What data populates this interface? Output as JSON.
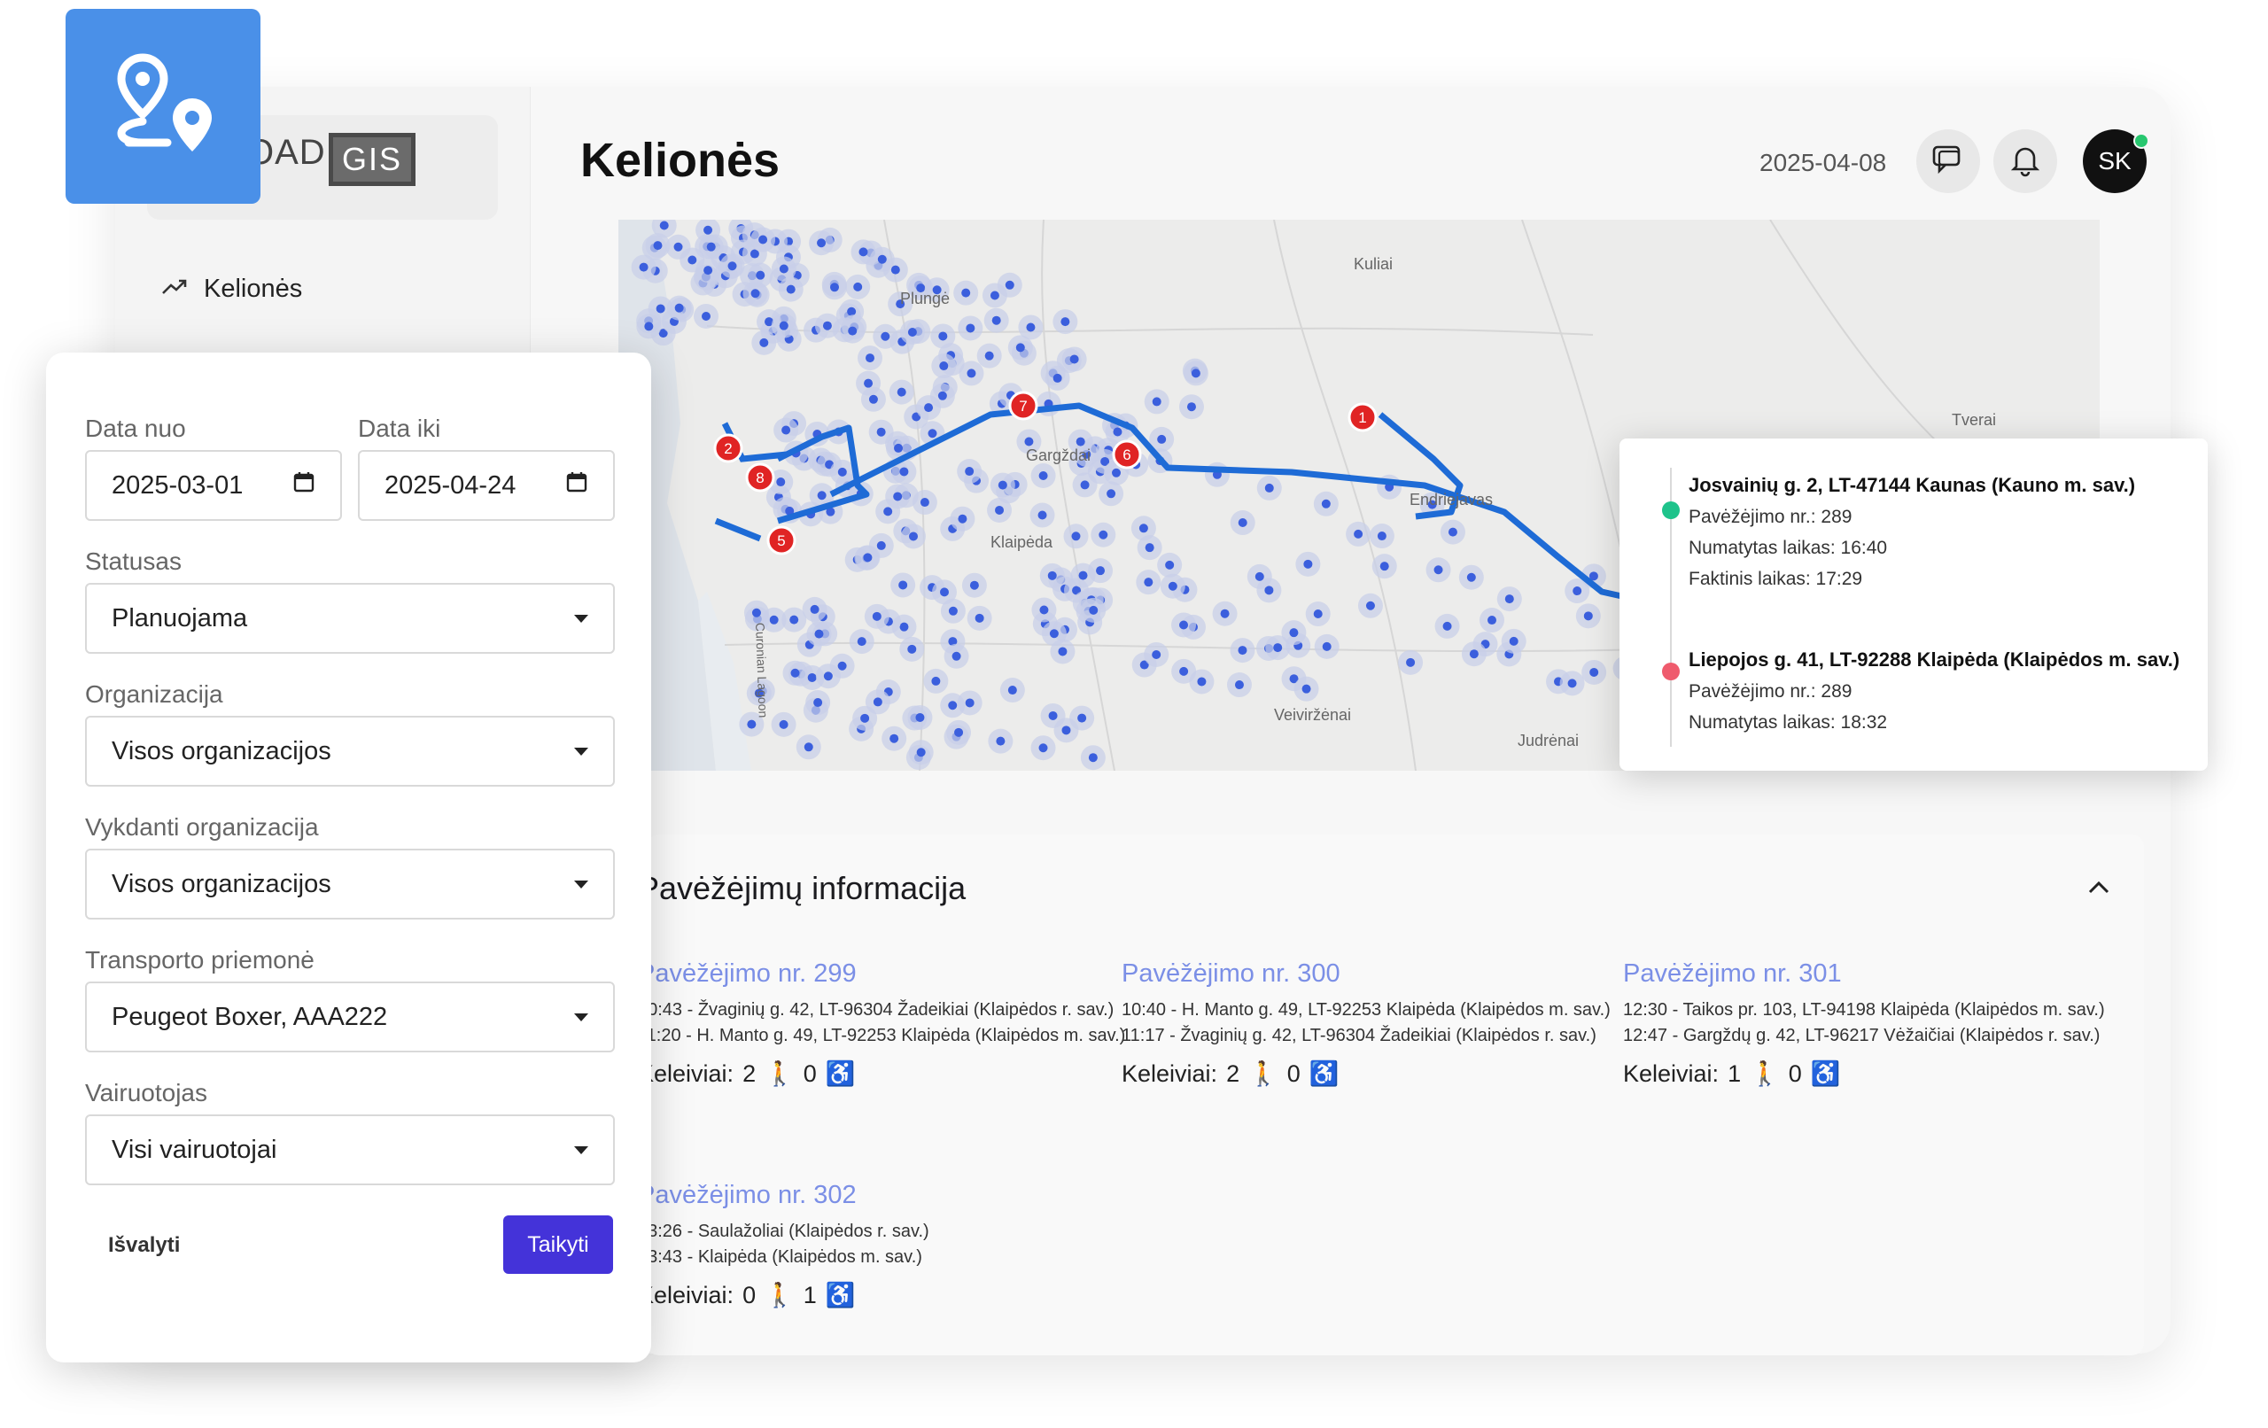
{
  "app": {
    "logo_text": "OAD",
    "logo_gis": "GIS",
    "page_title": "Kelionės",
    "date": "2025-04-08",
    "user_initials": "SK"
  },
  "sidebar": {
    "items": [
      {
        "label": "Kelionės",
        "icon": "trend-icon"
      }
    ]
  },
  "filters": {
    "date_from_label": "Data nuo",
    "date_from_value": "2025-03-01",
    "date_to_label": "Data iki",
    "date_to_value": "2025-04-24",
    "status_label": "Statusas",
    "status_value": "Planuojama",
    "organization_label": "Organizacija",
    "organization_value": "Visos organizacijos",
    "executing_org_label": "Vykdanti organizacija",
    "executing_org_value": "Visos organizacijos",
    "vehicle_label": "Transporto priemonė",
    "vehicle_value": "Peugeot Boxer, AAA222",
    "driver_label": "Vairuotojas",
    "driver_value": "Visi vairuotojai",
    "clear_label": "Išvalyti",
    "apply_label": "Taikyti"
  },
  "map": {
    "places": [
      "Kuliai",
      "Tverai",
      "Plungė",
      "Gargždai",
      "Endriejavas",
      "Klaipėda",
      "Veiviržėnai",
      "Judrėnai",
      "Curonian Lagoon"
    ],
    "markers": [
      "1",
      "2",
      "5",
      "6",
      "7",
      "8"
    ],
    "colors": {
      "route": "#1e6bd6",
      "cluster": "#3b5fdd",
      "marker": "#e02424"
    }
  },
  "tooltip": {
    "stops": [
      {
        "address": "Josvainių g. 2, LT-47144 Kaunas (Kauno m. sav.)",
        "trip": "Pavėžėjimo nr.: 289",
        "planned": "Numatytas laikas: 16:40",
        "actual": "Faktinis laikas: 17:29",
        "color": "#1ec38b"
      },
      {
        "address": "Liepojos g. 41, LT-92288 Klaipėda (Klaipėdos m. sav.)",
        "trip": "Pavėžėjimo nr.: 289",
        "planned": "Numatytas laikas: 18:32",
        "color": "#ef5b6d"
      }
    ]
  },
  "info": {
    "title": "Pavėžėjimų informacija",
    "passengers_label": "Keleiviai:",
    "trips": [
      {
        "title": "Pavėžėjimo nr. 299",
        "lines": [
          "10:43 - Žvaginių g. 42, LT-96304 Žadeikiai (Klaipėdos r. sav.)",
          "11:20 - H. Manto g. 49, LT-92253 Klaipėda (Klaipėdos m. sav.)"
        ],
        "walkers": "2",
        "wheelchair": "0"
      },
      {
        "title": "Pavėžėjimo nr. 300",
        "lines": [
          "10:40 - H. Manto g. 49, LT-92253 Klaipėda (Klaipėdos m. sav.)",
          "11:17 - Žvaginių g. 42, LT-96304 Žadeikiai (Klaipėdos r. sav.)"
        ],
        "walkers": "2",
        "wheelchair": "0"
      },
      {
        "title": "Pavėžėjimo nr. 301",
        "lines": [
          "12:30 - Taikos pr. 103, LT-94198 Klaipėda (Klaipėdos m. sav.)",
          "12:47 - Gargždų g. 42, LT-96217 Vėžaičiai (Klaipėdos r. sav.)"
        ],
        "walkers": "1",
        "wheelchair": "0"
      },
      {
        "title": "Pavėžėjimo nr. 302",
        "lines": [
          "13:26 - Saulažoliai (Klaipėdos r. sav.)",
          "13:43 - Klaipėda (Klaipėdos m. sav.)"
        ],
        "walkers": "0",
        "wheelchair": "1"
      }
    ]
  }
}
